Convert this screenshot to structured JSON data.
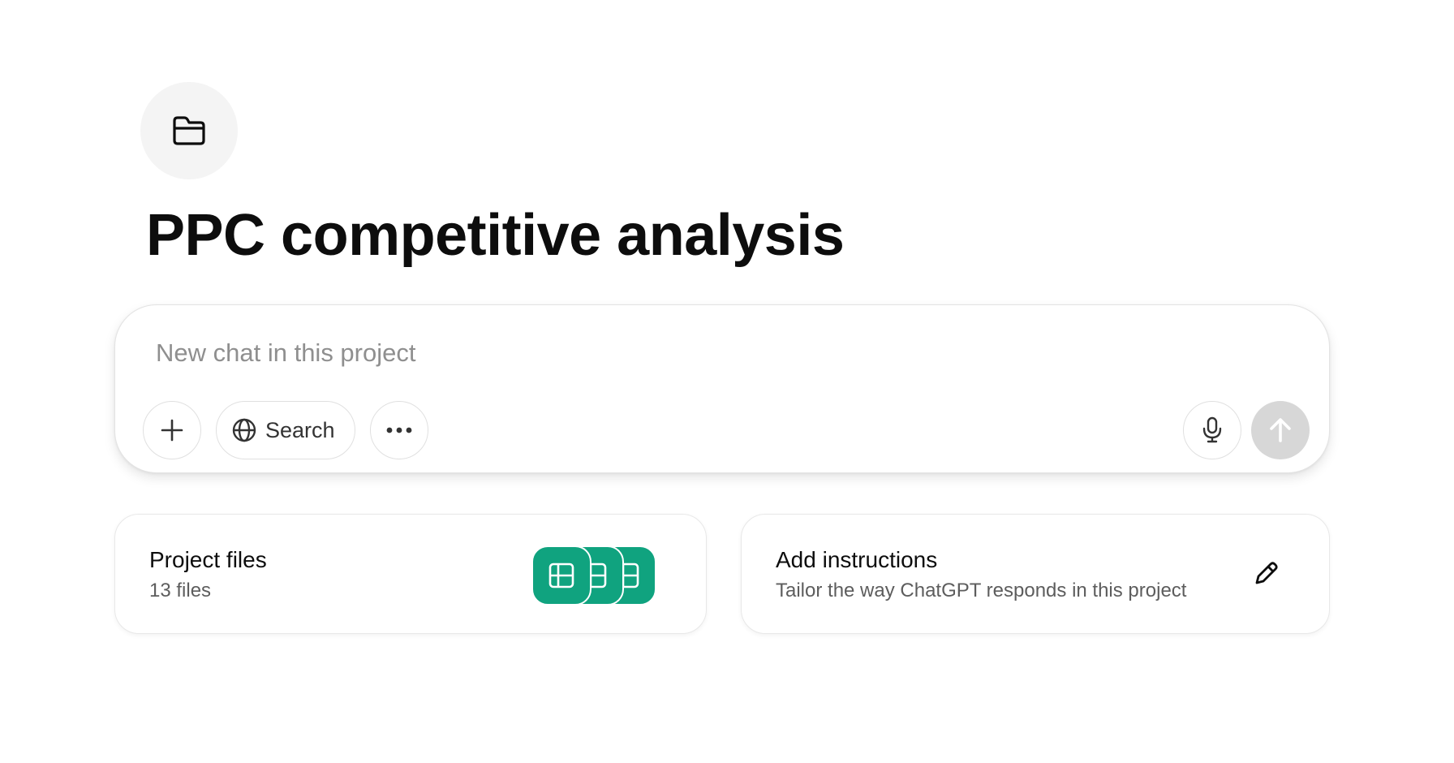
{
  "project": {
    "icon": "folder-icon",
    "title": "PPC competitive analysis"
  },
  "composer": {
    "placeholder": "New chat in this project",
    "value": "",
    "attach_icon": "plus-icon",
    "search_icon": "globe-icon",
    "search_label": "Search",
    "more_icon": "ellipsis-icon",
    "mic_icon": "microphone-icon",
    "send_icon": "arrow-up-icon"
  },
  "cards": {
    "files": {
      "title": "Project files",
      "subtitle": "13 files",
      "icon": "spreadsheet-icon"
    },
    "instructions": {
      "title": "Add instructions",
      "subtitle": "Tailor the way ChatGPT responds in this project",
      "icon": "pencil-icon"
    }
  },
  "colors": {
    "accent": "#10a37f",
    "icon_bg": "#f4f4f4",
    "send_disabled": "#d7d7d7"
  }
}
